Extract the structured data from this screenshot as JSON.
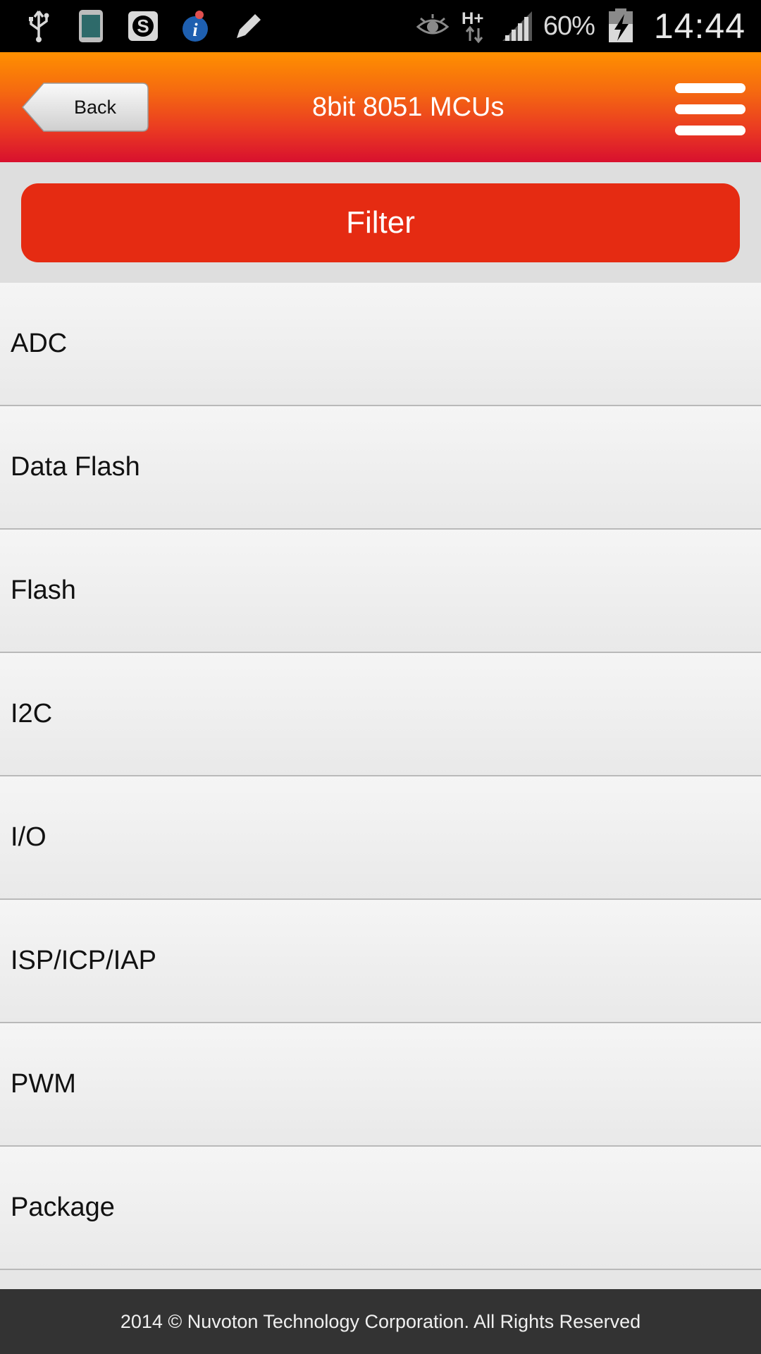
{
  "status_bar": {
    "left_icons": [
      "usb-icon",
      "phone-icon",
      "s-app-icon",
      "info-app-icon",
      "pencil-icon"
    ],
    "right_icons": [
      "eye-icon",
      "network-h-plus-icon",
      "signal-icon",
      "battery-charging-icon"
    ],
    "network_label": "H+",
    "battery_percent": "60%",
    "time": "14:44"
  },
  "header": {
    "back_label": "Back",
    "title": "8bit 8051 MCUs",
    "menu_icon": "hamburger-menu-icon"
  },
  "filter": {
    "label": "Filter"
  },
  "list": {
    "items": [
      {
        "label": "ADC"
      },
      {
        "label": "Data Flash"
      },
      {
        "label": "Flash"
      },
      {
        "label": "I2C"
      },
      {
        "label": "I/O"
      },
      {
        "label": "ISP/ICP/IAP"
      },
      {
        "label": "PWM"
      },
      {
        "label": "Package"
      }
    ]
  },
  "footer": {
    "text": "2014 © Nuvoton Technology Corporation. All Rights Reserved"
  },
  "colors": {
    "header_top": "#ff9000",
    "header_bottom": "#d8102e",
    "filter_button": "#e52b12",
    "footer_bg": "#333333"
  }
}
